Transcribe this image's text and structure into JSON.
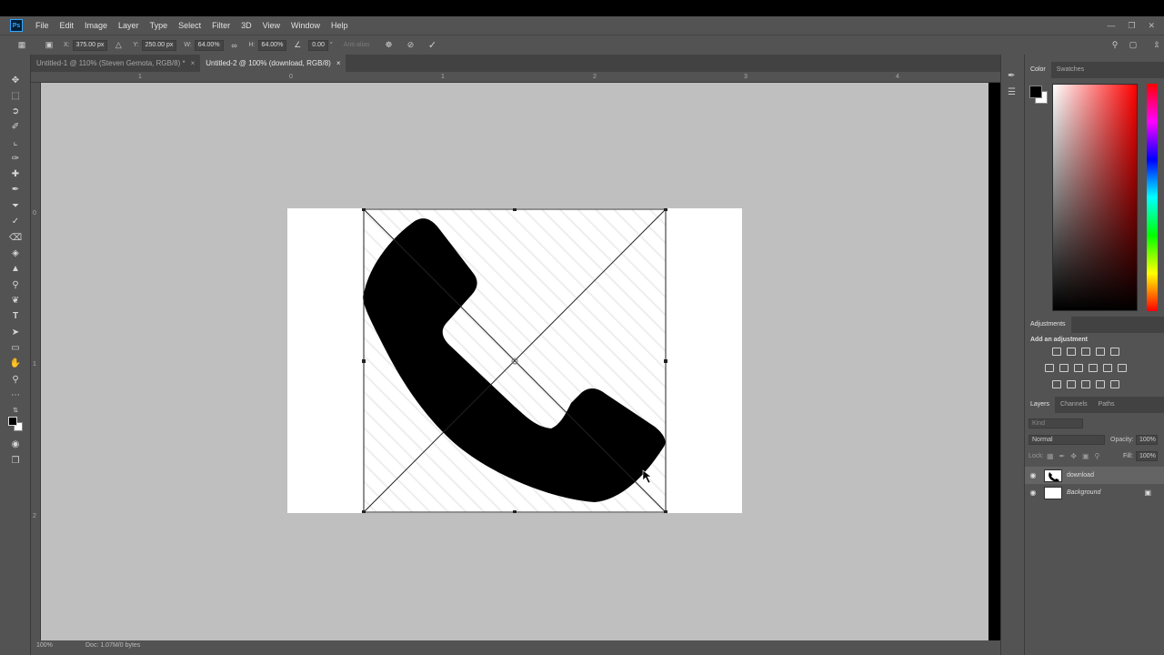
{
  "app": {
    "logo": "Ps"
  },
  "menu": [
    "File",
    "Edit",
    "Image",
    "Layer",
    "Type",
    "Select",
    "Filter",
    "3D",
    "View",
    "Window",
    "Help"
  ],
  "options": {
    "x_label": "X:",
    "x_value": "375.00 px",
    "y_label": "Y:",
    "y_value": "250.00 px",
    "w_label": "W:",
    "w_value": "64.00%",
    "h_label": "H:",
    "h_value": "64.00%",
    "angle_value": "0.00",
    "angle_unit": "°",
    "antialias": "Anti-alias"
  },
  "tabs": [
    {
      "label": "Untitled-1 @ 110% (Steven Gemota, RGB/8) *",
      "close": "×",
      "active": false
    },
    {
      "label": "Untitled-2 @ 100% (download, RGB/8)",
      "close": "×",
      "active": true
    }
  ],
  "ruler": {
    "h_marks": [
      "1",
      "0",
      "1",
      "2",
      "3",
      "4"
    ],
    "v_marks": [
      "0",
      "1",
      "2"
    ]
  },
  "color_panel": {
    "tabs": [
      "Color",
      "Swatches"
    ],
    "foreground": "#000000",
    "background": "#ffffff"
  },
  "adjustments": {
    "tab": "Adjustments",
    "title": "Add an adjustment"
  },
  "layers_panel": {
    "tabs": [
      "Layers",
      "Channels",
      "Paths"
    ],
    "kind_placeholder": "Kind",
    "blend_mode": "Normal",
    "opacity_label": "Opacity:",
    "opacity_value": "100%",
    "lock_label": "Lock:",
    "fill_label": "Fill:",
    "fill_value": "100%",
    "layers": [
      {
        "name": "download",
        "selected": true,
        "locked": false
      },
      {
        "name": "Background",
        "selected": false,
        "locked": true
      }
    ]
  },
  "status": {
    "zoom": "100%",
    "doc": "Doc: 1.07M/0 bytes"
  }
}
